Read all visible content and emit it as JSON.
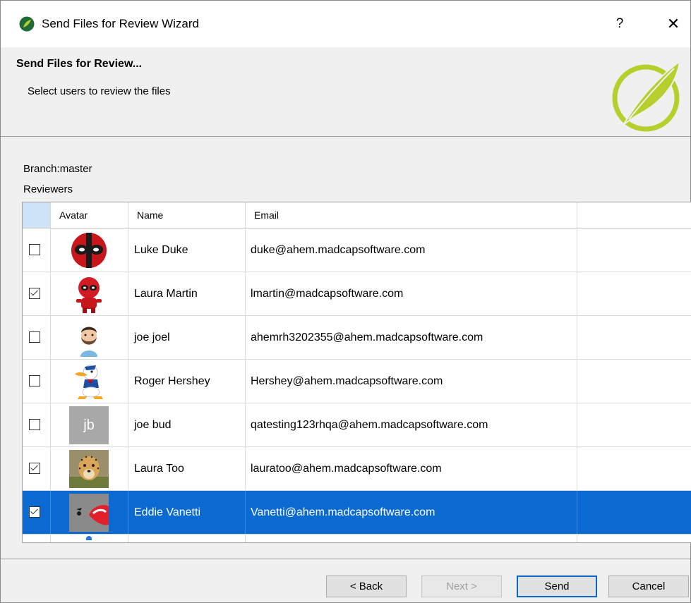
{
  "window": {
    "title": "Send Files for Review Wizard",
    "help_label": "?",
    "close_label": "✕"
  },
  "header": {
    "title": "Send Files for Review...",
    "subtitle": "Select users to review the files"
  },
  "branch": {
    "label": "Branch:",
    "value": "master"
  },
  "reviewers": {
    "label": "Reviewers",
    "columns": [
      "",
      "Avatar",
      "Name",
      "Email"
    ],
    "rows": [
      {
        "checked": false,
        "name": "Luke Duke",
        "email": "duke@ahem.madcapsoftware.com",
        "avatar": "deadpool-mask-icon"
      },
      {
        "checked": true,
        "name": "Laura Martin",
        "email": "lmartin@madcapsoftware.com",
        "avatar": "deadpool-figure-icon"
      },
      {
        "checked": false,
        "name": "joe joel",
        "email": "ahemrh3202355@ahem.madcapsoftware.com",
        "avatar": "bearded-man-icon"
      },
      {
        "checked": false,
        "name": "Roger Hershey",
        "email": "Hershey@ahem.madcapsoftware.com",
        "avatar": "donald-duck-icon"
      },
      {
        "checked": false,
        "name": "joe bud",
        "email": "qatesting123rhqa@ahem.madcapsoftware.com",
        "avatar": "initials-avatar",
        "initials": "jb"
      },
      {
        "checked": true,
        "name": "Laura Too",
        "email": "lauratoo@ahem.madcapsoftware.com",
        "avatar": "cheetah-photo-icon"
      },
      {
        "checked": true,
        "name": "Eddie Vanetti",
        "email": "Vanetti@ahem.madcapsoftware.com",
        "avatar": "race-car-icon",
        "selected": true
      }
    ]
  },
  "buttons": {
    "back": "< Back",
    "next": "Next >",
    "send": "Send",
    "cancel": "Cancel"
  },
  "colors": {
    "selection": "#0a6ad1",
    "logo_green": "#b6cf2c"
  }
}
